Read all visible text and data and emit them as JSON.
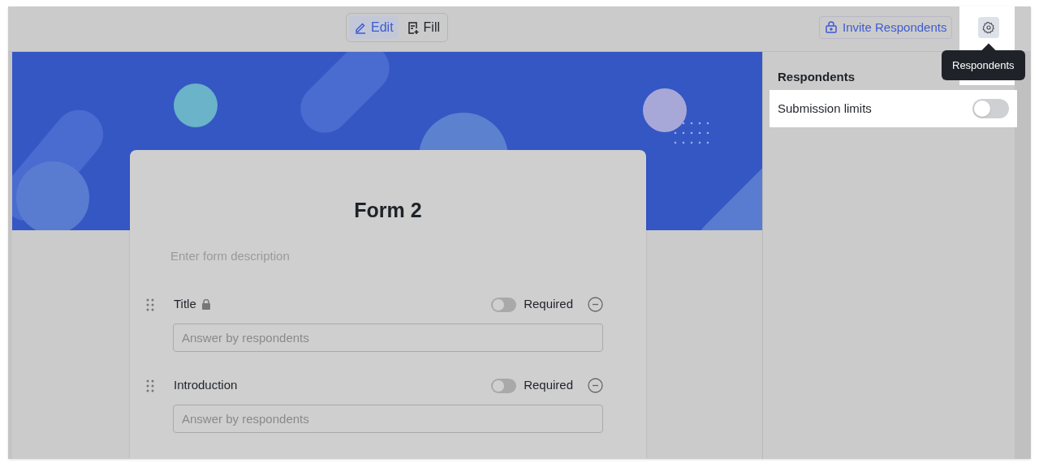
{
  "toolbar": {
    "mode_tabs": [
      {
        "label": "Edit",
        "selected": true
      },
      {
        "label": "Fill",
        "selected": false
      }
    ],
    "invite_button": "Invite Respondents",
    "settings_tooltip": "Respondents"
  },
  "form": {
    "title": "Form 2",
    "description_placeholder": "Enter form description",
    "questions": [
      {
        "label": "Title",
        "locked": true,
        "required": false,
        "required_label": "Required",
        "placeholder": "Answer by respondents"
      },
      {
        "label": "Introduction",
        "locked": false,
        "required": false,
        "required_label": "Required",
        "placeholder": "Answer by respondents"
      }
    ]
  },
  "settings_panel": {
    "heading": "Respondents",
    "options": [
      {
        "label": "Submission limits",
        "on": false
      }
    ]
  }
}
